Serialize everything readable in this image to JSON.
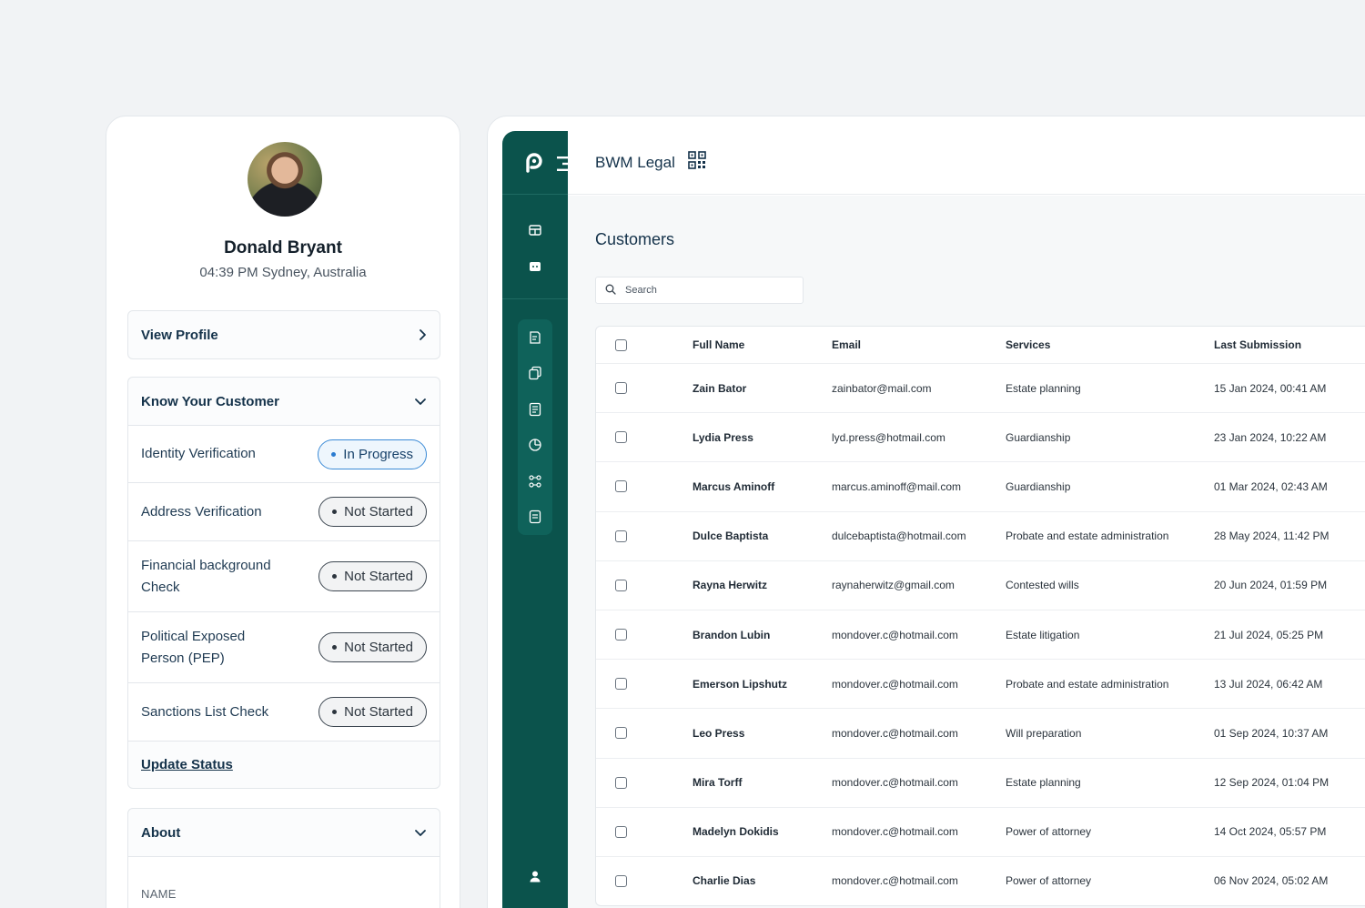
{
  "profile": {
    "name": "Donald Bryant",
    "subtitle": "04:39 PM Sydney, Australia",
    "view_profile_label": "View Profile",
    "kyc": {
      "title": "Know Your Customer",
      "items": [
        {
          "label": "Identity Verification",
          "status": "In Progress",
          "state": "progress"
        },
        {
          "label": "Address Verification",
          "status": "Not Started",
          "state": "notstarted"
        },
        {
          "label": "Financial background Check",
          "status": "Not Started",
          "state": "notstarted"
        },
        {
          "label": "Political Exposed Person (PEP)",
          "status": "Not Started",
          "state": "notstarted"
        },
        {
          "label": "Sanctions List Check",
          "status": "Not Started",
          "state": "notstarted"
        }
      ],
      "update_label": "Update Status"
    },
    "about": {
      "title": "About",
      "field_label": "NAME"
    }
  },
  "app": {
    "brand": "BWM Legal",
    "page_title": "Customers",
    "search_placeholder": "Search",
    "colors": {
      "sidebar": "#0b534c",
      "accent": "#14324a"
    },
    "table": {
      "headers": [
        "Full Name",
        "Email",
        "Services",
        "Last Submission"
      ],
      "rows": [
        {
          "name": "Zain Bator",
          "email": "zainbator@mail.com",
          "service": "Estate planning",
          "date": "15 Jan 2024, 00:41 AM",
          "avatar": "#3b2f2a"
        },
        {
          "name": "Lydia Press",
          "email": "lyd.press@hotmail.com",
          "service": "Guardianship",
          "date": "23 Jan 2024, 10:22 AM",
          "avatar": "#4a3b30"
        },
        {
          "name": "Marcus Aminoff",
          "email": "marcus.aminoff@mail.com",
          "service": "Guardianship",
          "date": "01 Mar 2024, 02:43 AM",
          "avatar": "#8a5a4a"
        },
        {
          "name": "Dulce Baptista",
          "email": "dulcebaptista@hotmail.com",
          "service": "Probate and estate administration",
          "date": "28 May 2024, 11:42 PM",
          "avatar": "#b89a80"
        },
        {
          "name": "Rayna Herwitz",
          "email": "raynaherwitz@gmail.com",
          "service": "Contested wills",
          "date": "20 Jun 2024, 01:59 PM",
          "avatar": "#c99a7a"
        },
        {
          "name": "Brandon Lubin",
          "email": "mondover.c@hotmail.com",
          "service": "Estate litigation",
          "date": "21 Jul 2024, 05:25 PM",
          "avatar": "#5a5a5a"
        },
        {
          "name": "Emerson Lipshutz",
          "email": "mondover.c@hotmail.com",
          "service": "Probate and estate administration",
          "date": "13 Jul 2024, 06:42 AM",
          "avatar": "#5a2f22"
        },
        {
          "name": "Leo Press",
          "email": "mondover.c@hotmail.com",
          "service": "Will preparation",
          "date": "01 Sep 2024, 10:37 AM",
          "avatar": "#4a4a3a"
        },
        {
          "name": "Mira Torff",
          "email": "mondover.c@hotmail.com",
          "service": "Estate planning",
          "date": "12 Sep 2024, 01:04 PM",
          "avatar": "#a04a2a"
        },
        {
          "name": "Madelyn Dokidis",
          "email": "mondover.c@hotmail.com",
          "service": "Power of attorney",
          "date": "14 Oct 2024, 05:57 PM",
          "avatar": "#9a8ab0"
        },
        {
          "name": "Charlie Dias",
          "email": "mondover.c@hotmail.com",
          "service": "Power of attorney",
          "date": "06 Nov 2024, 05:02 AM",
          "avatar": "#3a3a3a"
        }
      ]
    }
  }
}
